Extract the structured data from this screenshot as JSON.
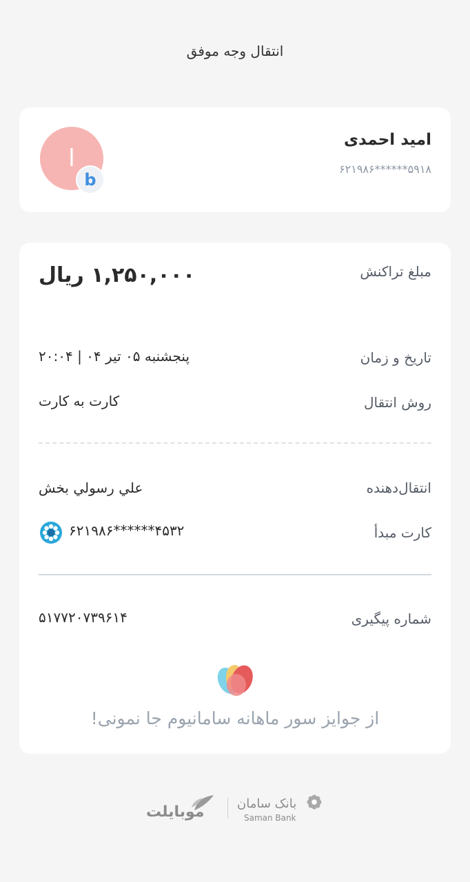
{
  "header": {
    "title": "انتقال وجه موفق"
  },
  "recipient": {
    "name": "امید احمدی",
    "card_masked": "۶۲۱۹۸۶******۵۹۱۸",
    "avatar_initial": "ا",
    "bank_badge_letter": "b"
  },
  "details": {
    "amount_label": "مبلغ تراکنش",
    "amount_value": "۱,۲۵۰,۰۰۰ ریال",
    "datetime_label": "تاریخ و زمان",
    "datetime_value": "پنجشنبه ۰۵ تیر ۰۴ | ۲۰:۰۴",
    "method_label": "روش انتقال",
    "method_value": "کارت به کارت",
    "sender_label": "انتقال‌دهنده",
    "sender_value": "علي رسولي بخش",
    "source_card_label": "کارت مبدأ",
    "source_card_value": "۶۲۱۹۸۶******۴۵۳۲",
    "tracking_label": "شماره پیگیری",
    "tracking_value": "۵۱۷۷۲۰۷۳۹۶۱۴"
  },
  "promo": {
    "text": "از جوایز سور ماهانه سامانیوم جا نمونی!"
  },
  "footer": {
    "mobilet": "موبایلت",
    "saman_fa": "بانک سامان",
    "saman_en": "Saman Bank"
  },
  "colors": {
    "avatar_bg": "#f6b5b2",
    "badge_text": "#3f8fe0",
    "promo_text": "#9aa4ae"
  }
}
